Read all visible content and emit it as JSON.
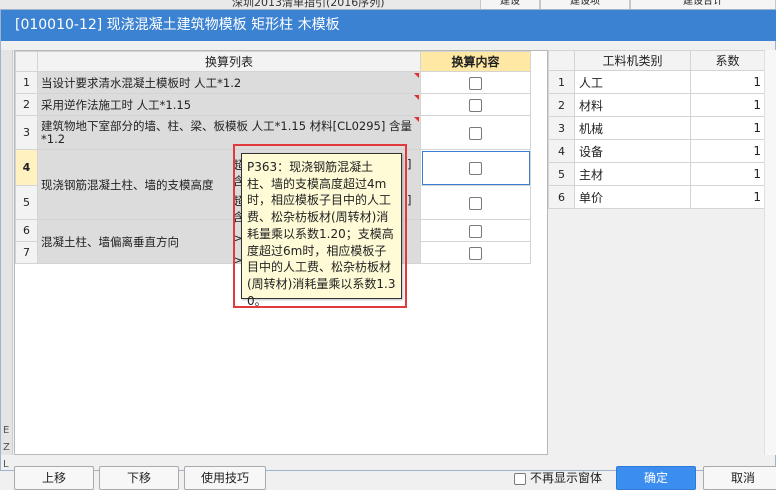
{
  "background": {
    "top_text": "深圳2013清单指引(2016序列)",
    "top_tab_1": "建设",
    "top_tab_2": "建设项",
    "top_tab_3": "建设合计"
  },
  "dialog": {
    "title": "[010010-12] 现浇混凝土建筑物模板 矩形柱 木模板"
  },
  "left_table": {
    "headers": {
      "list": "换算列表",
      "content": "换算内容"
    },
    "rows": [
      {
        "num": "1",
        "desc": "当设计要求清水混凝土模板时 人工*1.2",
        "checked": false
      },
      {
        "num": "2",
        "desc": "采用逆作法施工时 人工*1.15",
        "checked": false
      },
      {
        "num": "3",
        "desc": "建筑物地下室部分的墙、柱、梁、板模板 人工*1.15 材料[CL0295] 含量*1.2",
        "checked": false
      },
      {
        "num": "4",
        "desc": "现浇钢筋混凝土柱、墙的支模高度",
        "checked": false
      },
      {
        "num": "5",
        "desc": "",
        "checked": false
      },
      {
        "num": "6",
        "desc": "混凝土柱、墙偏离垂直方向",
        "checked": false
      },
      {
        "num": "7",
        "desc": "",
        "checked": false
      }
    ],
    "hidden_fragments": {
      "r4_a": "超",
      "r4_b": "含",
      "r5_a": "超",
      "r5_b": "含",
      "r6": ">",
      "r7": ">",
      "bracket_a": "]",
      "bracket_b": "]"
    }
  },
  "tooltip": {
    "text": "P363：现浇钢筋混凝土柱、墙的支模高度超过4m时，相应模板子目中的人工费、松杂枋板材(周转材)消耗量乘以系数1.20；支模高度超过6m时，相应模板子目中的人工费、松杂枋板材(周转材)消耗量乘以系数1.30。"
  },
  "right_table": {
    "headers": {
      "type": "工料机类别",
      "coef": "系数"
    },
    "rows": [
      {
        "num": "1",
        "type": "人工",
        "coef": "1"
      },
      {
        "num": "2",
        "type": "材料",
        "coef": "1"
      },
      {
        "num": "3",
        "type": "机械",
        "coef": "1"
      },
      {
        "num": "4",
        "type": "设备",
        "coef": "1"
      },
      {
        "num": "5",
        "type": "主材",
        "coef": "1"
      },
      {
        "num": "6",
        "type": "单价",
        "coef": "1"
      }
    ]
  },
  "buttons": {
    "up": "上移",
    "down": "下移",
    "tips": "使用技巧",
    "no_more": "不再显示窗体",
    "ok": "确定",
    "cancel": "取消"
  },
  "colors": {
    "titlebar": "#3c82d2",
    "highlight_header": "#ffe8a3",
    "tooltip_bg": "#fffbd6",
    "annotation_box": "#e23a3a"
  }
}
